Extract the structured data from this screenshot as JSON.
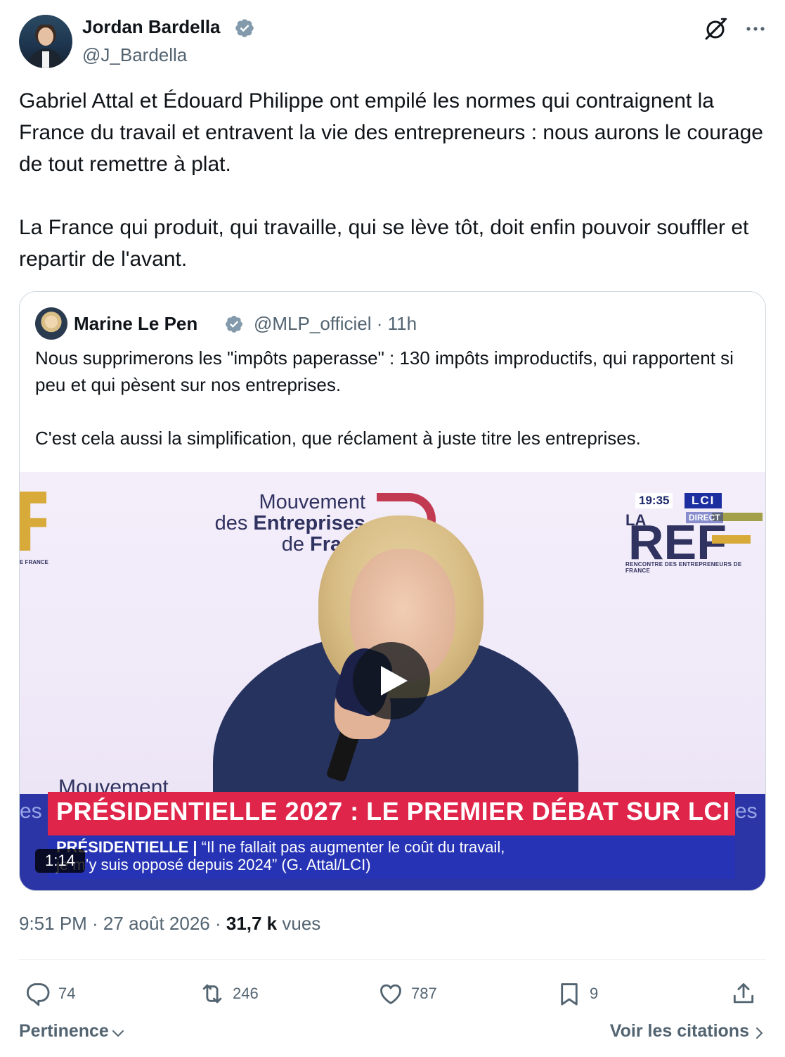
{
  "author": {
    "name": "Jordan Bardella",
    "handle": "@J_Bardella"
  },
  "tweet": {
    "paragraph1": "Gabriel Attal et Édouard Philippe ont empilé les normes qui contraignent la France du travail et entravent la vie des entrepreneurs : nous aurons le courage de tout remettre à plat.",
    "paragraph2": "La France qui produit, qui travaille, qui se lève tôt, doit enfin pouvoir souffler et repartir de l'avant."
  },
  "quoted": {
    "name": "Marine Le Pen",
    "handle_time": "@MLP_officiel · 11h",
    "paragraph1": "Nous supprimerons les \"impôts paperasse\" : 130 impôts improductifs, qui rapportent si peu et qui pèsent sur nos entreprises.",
    "paragraph2": "C'est cela aussi la simplification, que réclament à juste titre les entreprises.",
    "video": {
      "duration": "1:14",
      "logo_line1": "Mouvement",
      "logo_line2_a": "des ",
      "logo_line2_b": "Entreprises",
      "logo_line3_a": "de ",
      "logo_line3_b": "Franc",
      "logo_bottom": "Mouvement",
      "side_left_text": "E FRANCE",
      "ref_text": "REF",
      "ref_la": "LA",
      "ref_subtitle": "RENCONTRE DES ENTREPRENEURS DE FRANCE",
      "clock": "19:35",
      "channel": "LCI",
      "live": "DIRECT",
      "banner_title": "PRÉSIDENTIELLE 2027 : LE PREMIER DÉBAT SUR LCI",
      "banner_tag": "PRÉSIDENTIELLE | ",
      "banner_line1": "“Il ne fallait pas augmenter le coût du travail,",
      "banner_line2": "je m’y suis opposé depuis 2024” (G. Attal/LCI)",
      "side_es": "es"
    }
  },
  "meta": {
    "datetime": "9:51 PM · 27 août 2026 · ",
    "views_count": "31,7 k",
    "views_label": " vues"
  },
  "actions": {
    "replies": "74",
    "retweets": "246",
    "likes": "787",
    "bookmarks": "9"
  },
  "footer": {
    "sort_label": "Pertinence",
    "quotes_label": "Voir les citations"
  },
  "colors": {
    "verified": "#829aab",
    "text_secondary": "#536471",
    "banner_red": "#e0254a",
    "banner_blue": "#2633b5"
  }
}
